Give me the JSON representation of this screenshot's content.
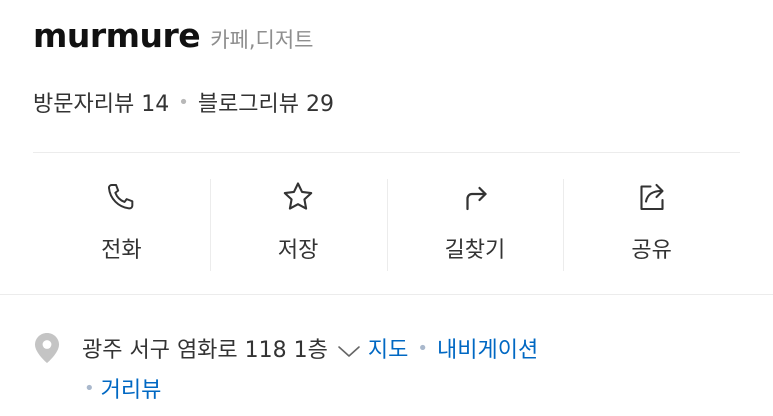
{
  "place": {
    "name": "murmure",
    "category": "카페,디저트"
  },
  "reviews": {
    "visitor_label": "방문자리뷰 14",
    "separator": "•",
    "blog_label": "블로그리뷰 29"
  },
  "actions": [
    {
      "label": "전화",
      "icon": "phone-icon"
    },
    {
      "label": "저장",
      "icon": "star-icon"
    },
    {
      "label": "길찾기",
      "icon": "directions-icon"
    },
    {
      "label": "공유",
      "icon": "share-icon"
    }
  ],
  "address": {
    "text": "광주 서구 염화로 118 1층",
    "map_link": "지도",
    "navigation_link": "내비게이션",
    "street_view_link": "거리뷰",
    "separator": "•"
  },
  "colors": {
    "link": "#0068c3",
    "muted": "#8e8e8e",
    "divider": "#ececec"
  }
}
